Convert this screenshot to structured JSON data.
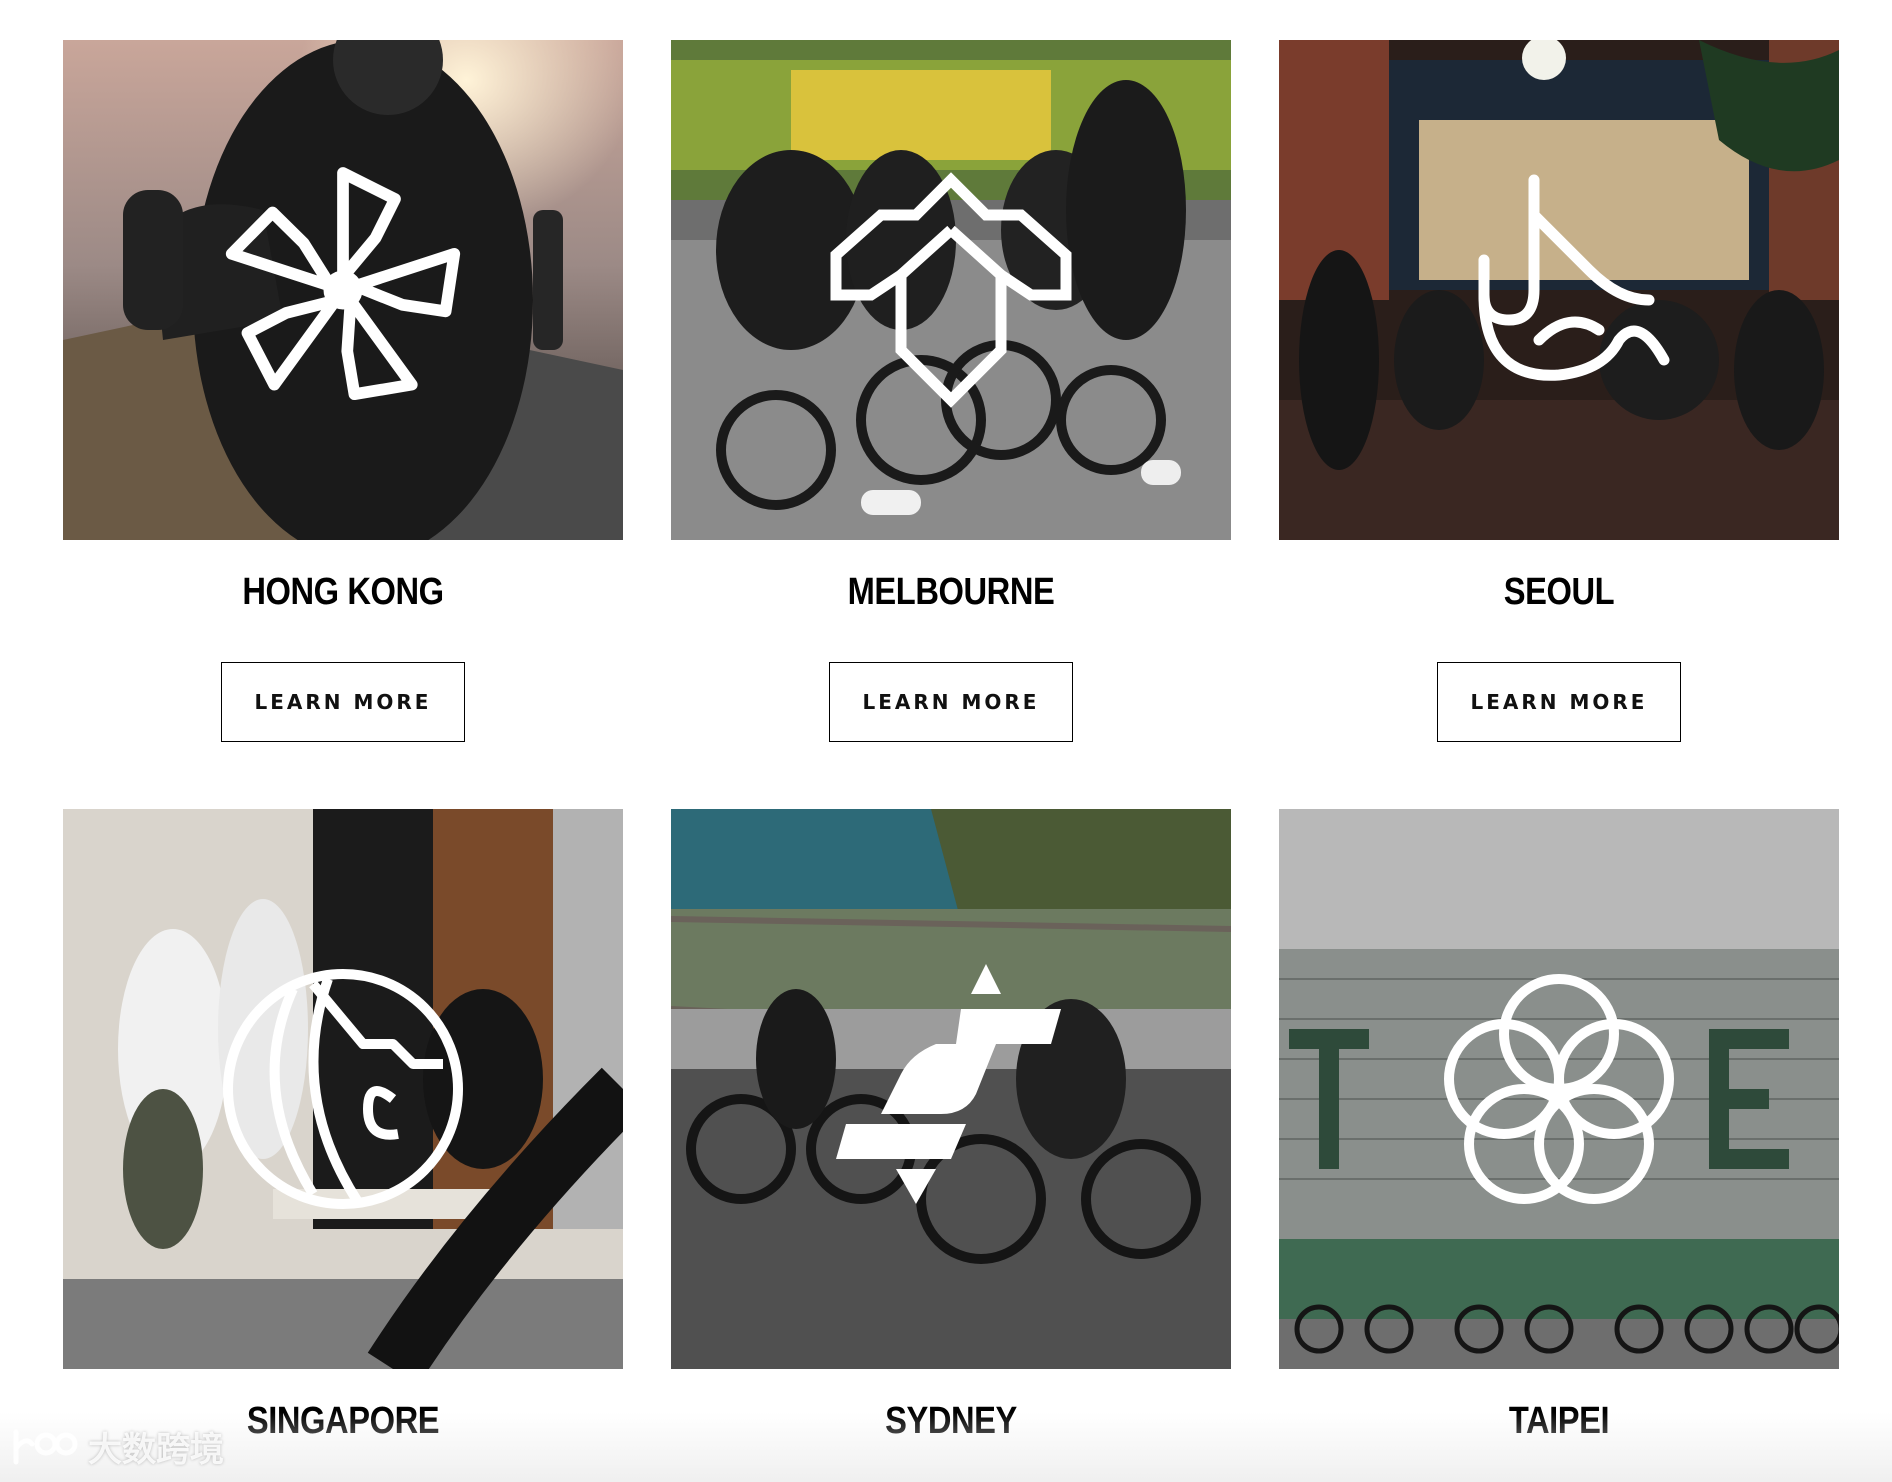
{
  "locations": [
    {
      "city": "HONG KONG",
      "button": "LEARN MORE",
      "icon": "hong-kong-pinwheel-icon"
    },
    {
      "city": "MELBOURNE",
      "button": "LEARN MORE",
      "icon": "melbourne-chevron-icon"
    },
    {
      "city": "SEOUL",
      "button": "LEARN MORE",
      "icon": "seoul-wave-icon"
    },
    {
      "city": "SINGAPORE",
      "icon": "singapore-globe-icon"
    },
    {
      "city": "SYDNEY",
      "icon": "sydney-s-icon"
    },
    {
      "city": "TAIPEI",
      "icon": "taipei-flower-icon"
    }
  ],
  "watermark": {
    "text": "大数跨境"
  },
  "colors": {
    "text": "#000000",
    "button_border": "#000000",
    "logo": "#ffffff",
    "background": "#ffffff"
  }
}
